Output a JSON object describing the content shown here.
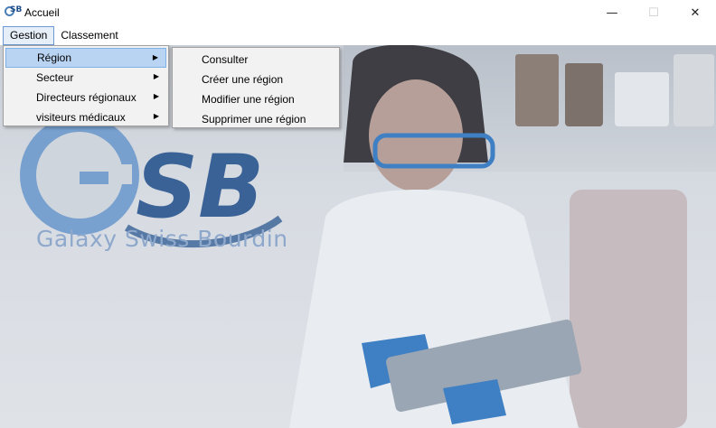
{
  "window": {
    "title": "Accueil",
    "minimize_glyph": "—",
    "maximize_glyph": "☐",
    "close_glyph": "✕",
    "icon": "gsb-app-icon"
  },
  "menubar": {
    "items": [
      {
        "label": "Gestion"
      },
      {
        "label": "Classement"
      }
    ]
  },
  "gestion_menu": {
    "items": [
      {
        "label": "Région",
        "has_submenu": true,
        "highlighted": true
      },
      {
        "label": "Secteur",
        "has_submenu": true
      },
      {
        "label": "Directeurs régionaux",
        "has_submenu": true
      },
      {
        "label": "visiteurs médicaux",
        "has_submenu": true
      }
    ],
    "submenu_arrow": "▶"
  },
  "region_submenu": {
    "items": [
      {
        "label": "Consulter"
      },
      {
        "label": "Créer une région"
      },
      {
        "label": "Modifier une région"
      },
      {
        "label": "Supprimer une région"
      }
    ]
  },
  "background": {
    "logo_text": "Galaxy Swiss Bourdin",
    "brand_colors": {
      "logo_blue": "#4b7fb8",
      "logo_dark": "#1f4e8a"
    }
  }
}
